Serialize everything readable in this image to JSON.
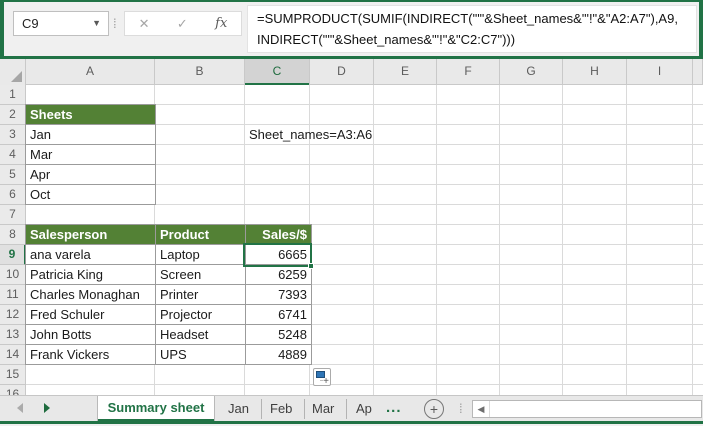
{
  "colors": {
    "excel_green": "#217346",
    "table_header_green": "#538135",
    "selection_border": "#217346"
  },
  "name_box": {
    "value": "C9"
  },
  "formula_bar": {
    "cancel_icon": "✕",
    "enter_icon": "✓",
    "fx_label": "fx",
    "line1": "=SUMPRODUCT(SUMIF(INDIRECT(\"'\"&Sheet_names&\"'!\"&\"A2:A7\"),A9,",
    "line2": "INDIRECT(\"'\"&Sheet_names&\"'!\"&\"C2:C7\")))"
  },
  "grid": {
    "column_headers": [
      "A",
      "B",
      "C",
      "D",
      "E",
      "F",
      "G",
      "H",
      "I"
    ],
    "selected_column": "C",
    "row_numbers": [
      "1",
      "2",
      "3",
      "4",
      "5",
      "6",
      "7",
      "8",
      "9",
      "10",
      "11",
      "12",
      "13",
      "14",
      "15",
      "16"
    ],
    "selected_row": "9"
  },
  "sheets_list": {
    "header": "Sheets",
    "items": [
      "Jan",
      "Mar",
      "Apr",
      "Oct"
    ]
  },
  "annotation": "Sheet_names=A3:A6",
  "sales_table": {
    "headers": [
      "Salesperson",
      "Product",
      "Sales/$"
    ],
    "rows": [
      {
        "salesperson": "ana varela",
        "product": "Laptop",
        "sales": "6665"
      },
      {
        "salesperson": "Patricia King",
        "product": "Screen",
        "sales": "6259"
      },
      {
        "salesperson": "Charles Monaghan",
        "product": "Printer",
        "sales": "7393"
      },
      {
        "salesperson": "Fred Schuler",
        "product": "Projector",
        "sales": "6741"
      },
      {
        "salesperson": "John Botts",
        "product": "Headset",
        "sales": "5248"
      },
      {
        "salesperson": "Frank Vickers",
        "product": "UPS",
        "sales": "4889"
      }
    ]
  },
  "selection": {
    "cell": "C9",
    "value": "6665"
  },
  "sheet_tabs": {
    "active": "Summary sheet",
    "others": [
      "Jan",
      "Feb",
      "Mar",
      "Ap"
    ],
    "overflow_indicator": "...",
    "plus_label": "+"
  }
}
